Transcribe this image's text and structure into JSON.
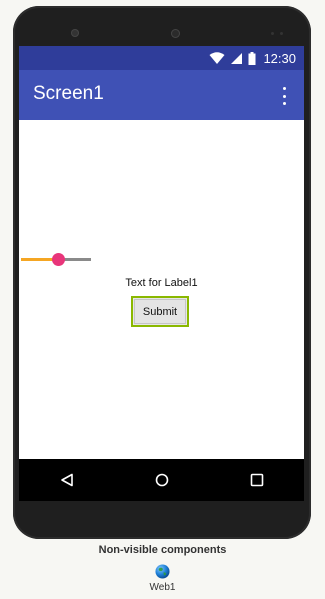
{
  "status_bar": {
    "time": "12:30",
    "icons": [
      "wifi-icon",
      "signal-icon",
      "battery-icon"
    ]
  },
  "app_bar": {
    "title": "Screen1",
    "menu_icon": "overflow-menu-icon"
  },
  "slider": {
    "value_fraction": 0.55,
    "active_color": "#f5a623",
    "thumb_color": "#e8357a",
    "inactive_color": "#8a8a8a"
  },
  "label1": {
    "text": "Text for Label1"
  },
  "submit_button": {
    "label": "Submit"
  },
  "nav_bar": {
    "buttons": [
      "back-icon",
      "home-icon",
      "recents-icon"
    ]
  },
  "non_visible": {
    "title": "Non-visible components",
    "items": [
      {
        "label": "Web1",
        "icon": "globe-icon"
      }
    ]
  },
  "colors": {
    "status_bar": "#2f3d9a",
    "app_bar": "#3f51b5",
    "button_border": "#8ab800",
    "page_bg": "#f7f7f3"
  }
}
